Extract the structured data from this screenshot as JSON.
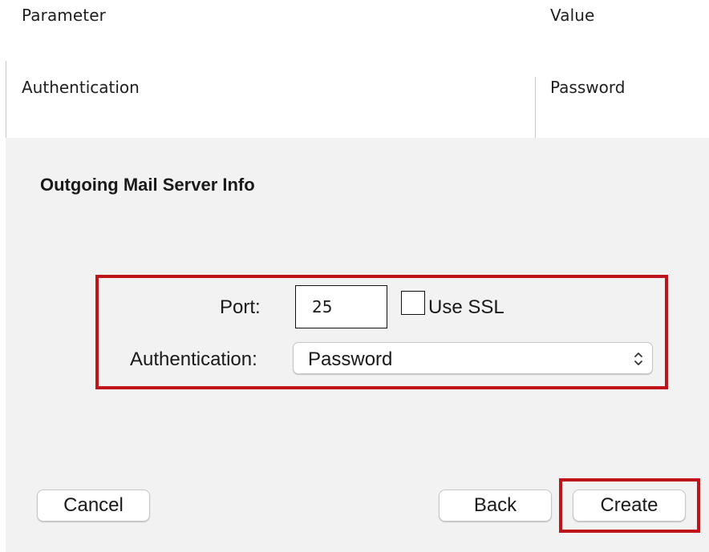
{
  "doc_table": {
    "headers": {
      "parameter": "Parameter",
      "value": "Value"
    },
    "rows": [
      {
        "parameter": "Authentication",
        "value": "Password"
      }
    ]
  },
  "dialog": {
    "title": "Outgoing Mail Server Info",
    "port": {
      "label": "Port:",
      "value": "25"
    },
    "ssl": {
      "label": "Use SSL",
      "checked": false
    },
    "authentication": {
      "label": "Authentication:",
      "selected": "Password"
    },
    "buttons": {
      "cancel": "Cancel",
      "back": "Back",
      "create": "Create"
    }
  },
  "colors": {
    "highlight": "#c0141b",
    "dialog_background": "#f2f2f2"
  },
  "icons": {
    "select_arrows": "chevron-up-down-icon"
  }
}
